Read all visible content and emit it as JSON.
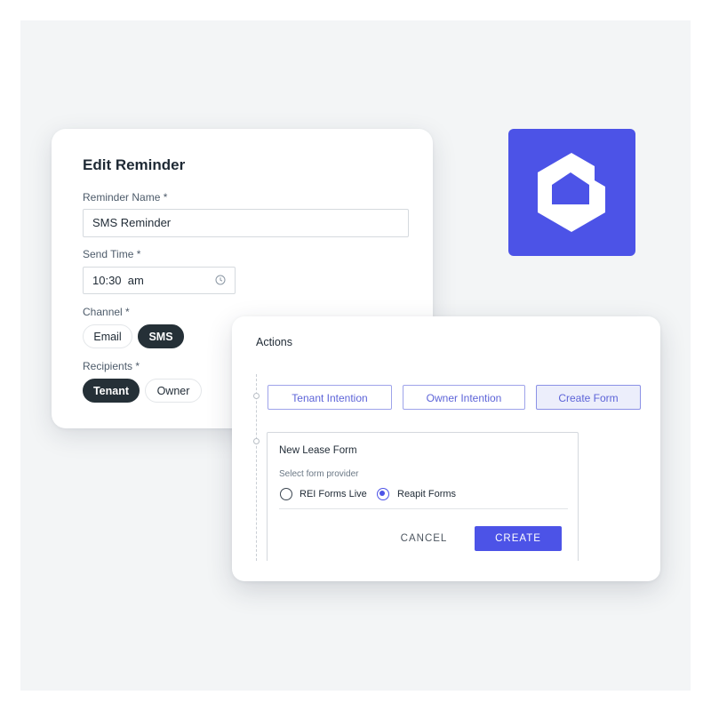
{
  "brand": {
    "accent": "#4c53e7",
    "dark_pill": "#253037"
  },
  "logo": {
    "icon": "house-hexagon-logo-icon"
  },
  "edit_reminder": {
    "title": "Edit Reminder",
    "reminder_name_label": "Reminder Name *",
    "reminder_name_value": "SMS Reminder",
    "send_time_label": "Send Time *",
    "send_time_value": "10:30  am",
    "send_time_icon": "clock-icon",
    "channel_label": "Channel *",
    "channel_options": [
      {
        "label": "Email",
        "selected": false
      },
      {
        "label": "SMS",
        "selected": true
      }
    ],
    "recipients_label": "Recipients *",
    "recipient_options": [
      {
        "label": "Tenant",
        "selected": true
      },
      {
        "label": "Owner",
        "selected": false
      }
    ]
  },
  "actions": {
    "title": "Actions",
    "buttons": [
      {
        "label": "Tenant Intention",
        "active": false
      },
      {
        "label": "Owner Intention",
        "active": false
      },
      {
        "label": "Create Form",
        "active": true
      }
    ],
    "form": {
      "title": "New Lease Form",
      "provider_label": "Select form provider",
      "providers": [
        {
          "label": "REI Forms Live",
          "selected": false
        },
        {
          "label": "Reapit Forms",
          "selected": true
        }
      ],
      "cancel_label": "CANCEL",
      "create_label": "CREATE"
    }
  }
}
